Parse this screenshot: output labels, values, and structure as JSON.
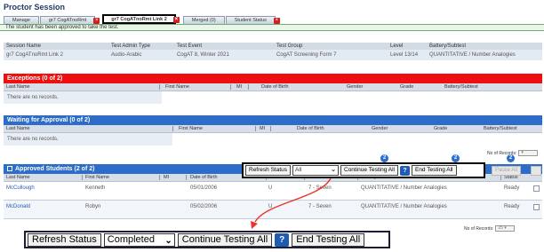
{
  "page": {
    "title": "Proctor Session"
  },
  "tabs": [
    {
      "label": "Manage"
    },
    {
      "label": "gr7 CogATnoRmt"
    },
    {
      "label": "gr7 CogATnoRmt Link 2"
    },
    {
      "label": "Merged  (0)"
    },
    {
      "label": "Student Status"
    }
  ],
  "message": "The student has been approved to take the test.",
  "session": {
    "headers": [
      "Session Name",
      "Test Admin Type",
      "Test Event",
      "Test Group",
      "Level",
      "Battery/Subtest"
    ],
    "values": [
      "gr7 CogATnoRmt Link 2",
      "Audio-Arabic",
      "CogAT 8, Winter 2021",
      "CogAT Screening Form 7",
      "Level 13/14",
      "QUANTITATIVE / Number Analogies"
    ]
  },
  "exceptions": {
    "title": "Exceptions  (0 of 2)",
    "headers": [
      "Last Name",
      "First Name",
      "MI",
      "Date of Birth",
      "Gender",
      "Grade",
      "Battery/Subtest"
    ],
    "empty": "There are no records."
  },
  "waiting": {
    "title": "Waiting for Approval (0 of 2)",
    "headers": [
      "Last Name",
      "First Name",
      "MI",
      "Date of Birth",
      "Gender",
      "Grade",
      "Battery/Subtest"
    ],
    "empty": "There are no records.",
    "records_label": "No of Records:"
  },
  "approved": {
    "title": "Approved Students (2 of 2)",
    "headers": [
      "Last Name",
      "First Name",
      "MI",
      "Date of Birth",
      "Gender",
      "Grade",
      "Battery/Subtest",
      "Status"
    ],
    "rows": [
      {
        "last": "McCullough",
        "first": "Kenneth",
        "mi": "",
        "dob": "05/01/2006",
        "gender": "U",
        "grade": "7 - Seven",
        "battery": "QUANTITATIVE / Number Analogies",
        "status": "Ready"
      },
      {
        "last": "McDonald",
        "first": "Robyn",
        "mi": "",
        "dob": "05/02/2006",
        "gender": "U",
        "grade": "7 - Seven",
        "battery": "QUANTITATIVE / Number Analogies",
        "status": "Ready"
      }
    ],
    "records_label": "No of Records:",
    "records_value": "25",
    "pause_label": "Pause All"
  },
  "small_toolbar": {
    "refresh": "Refresh Status",
    "filter": "All",
    "continue": "Continue Testing All",
    "help": "?",
    "end": "End Testing All"
  },
  "big_toolbar": {
    "refresh": "Refresh Status",
    "filter": "Completed",
    "continue": "Continue Testing All",
    "help": "?",
    "end": "End Testing All"
  },
  "badge": "2",
  "colors": {
    "exceptions_bar": "#ee0f0f",
    "section_bar": "#2d6cc7",
    "arrow": "#e8342c"
  }
}
